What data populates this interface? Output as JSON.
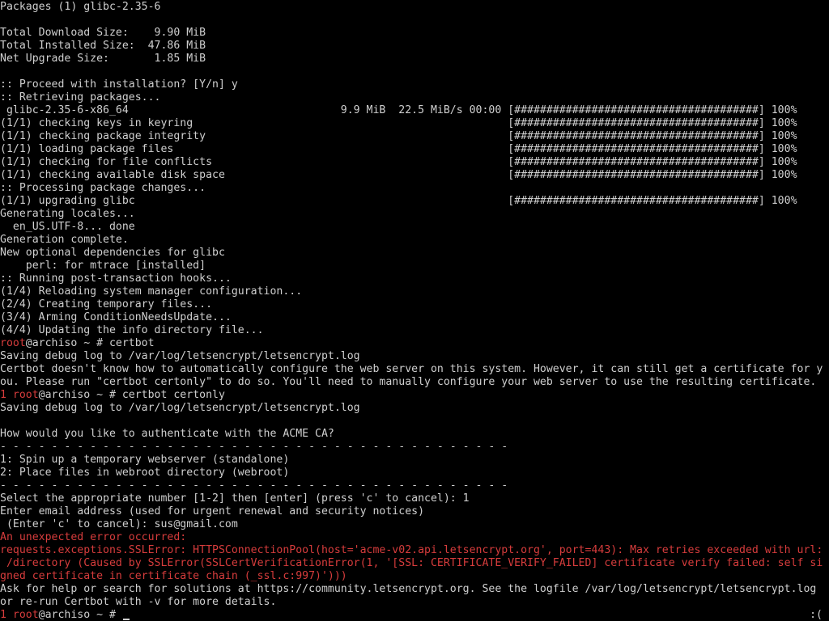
{
  "terminal": {
    "colors": {
      "background": "#000000",
      "text": "#cfcfcf",
      "prompt_and_error": "#d63c3c"
    },
    "lines": [
      {
        "t": "Packages (1) glibc-2.35-6"
      },
      {
        "t": ""
      },
      {
        "t": "Total Download Size:    9.90 MiB"
      },
      {
        "t": "Total Installed Size:  47.86 MiB"
      },
      {
        "t": "Net Upgrade Size:       1.85 MiB"
      },
      {
        "t": ""
      },
      {
        "t": ":: Proceed with installation? [Y/n] y"
      },
      {
        "t": ":: Retrieving packages..."
      },
      {
        "t": " glibc-2.35-6-x86_64                                 9.9 MiB  22.5 MiB/s 00:00 [######################################] 100%"
      },
      {
        "t": "(1/1) checking keys in keyring                                                 [######################################] 100%"
      },
      {
        "t": "(1/1) checking package integrity                                               [######################################] 100%"
      },
      {
        "t": "(1/1) loading package files                                                    [######################################] 100%"
      },
      {
        "t": "(1/1) checking for file conflicts                                              [######################################] 100%"
      },
      {
        "t": "(1/1) checking available disk space                                            [######################################] 100%"
      },
      {
        "t": ":: Processing package changes..."
      },
      {
        "t": "(1/1) upgrading glibc                                                          [######################################] 100%"
      },
      {
        "t": "Generating locales..."
      },
      {
        "t": "  en_US.UTF-8... done"
      },
      {
        "t": "Generation complete."
      },
      {
        "t": "New optional dependencies for glibc"
      },
      {
        "t": "    perl: for mtrace [installed]"
      },
      {
        "t": ":: Running post-transaction hooks..."
      },
      {
        "t": "(1/4) Reloading system manager configuration..."
      },
      {
        "t": "(2/4) Creating temporary files..."
      },
      {
        "t": "(3/4) Arming ConditionNeedsUpdate..."
      },
      {
        "t": "(4/4) Updating the info directory file..."
      },
      {
        "prompt": "root",
        "t": "@archiso ~ # certbot"
      },
      {
        "t": "Saving debug log to /var/log/letsencrypt/letsencrypt.log"
      },
      {
        "t": "Certbot doesn't know how to automatically configure the web server on this system. However, it can still get a certificate for y"
      },
      {
        "t": "ou. Please run \"certbot certonly\" to do so. You'll need to manually configure your web server to use the resulting certificate."
      },
      {
        "prompt": "1 root",
        "t": "@archiso ~ # certbot certonly"
      },
      {
        "t": "Saving debug log to /var/log/letsencrypt/letsencrypt.log"
      },
      {
        "t": ""
      },
      {
        "t": "How would you like to authenticate with the ACME CA?"
      },
      {
        "t": "- - - - - - - - - - - - - - - - - - - - - - - - - - - - - - - - - - - - - - - -"
      },
      {
        "t": "1: Spin up a temporary webserver (standalone)"
      },
      {
        "t": "2: Place files in webroot directory (webroot)"
      },
      {
        "t": "- - - - - - - - - - - - - - - - - - - - - - - - - - - - - - - - - - - - - - - -"
      },
      {
        "t": "Select the appropriate number [1-2] then [enter] (press 'c' to cancel): 1"
      },
      {
        "t": "Enter email address (used for urgent renewal and security notices)"
      },
      {
        "t": " (Enter 'c' to cancel): sus@gmail.com"
      },
      {
        "error": true,
        "t": "An unexpected error occurred:"
      },
      {
        "error": true,
        "t": "requests.exceptions.SSLError: HTTPSConnectionPool(host='acme-v02.api.letsencrypt.org', port=443): Max retries exceeded with url:"
      },
      {
        "error": true,
        "t": " /directory (Caused by SSLError(SSLCertVerificationError(1, '[SSL: CERTIFICATE_VERIFY_FAILED] certificate verify failed: self si"
      },
      {
        "error": true,
        "t": "gned certificate in certificate chain (_ssl.c:997)')))"
      },
      {
        "t": "Ask for help or search for solutions at https://community.letsencrypt.org. See the logfile /var/log/letsencrypt/letsencrypt.log"
      },
      {
        "t": "or re-run Certbot with -v for more details."
      },
      {
        "prompt": "1 root",
        "t": "@archiso ~ # ",
        "current": true
      }
    ],
    "status_indicator": ":("
  }
}
